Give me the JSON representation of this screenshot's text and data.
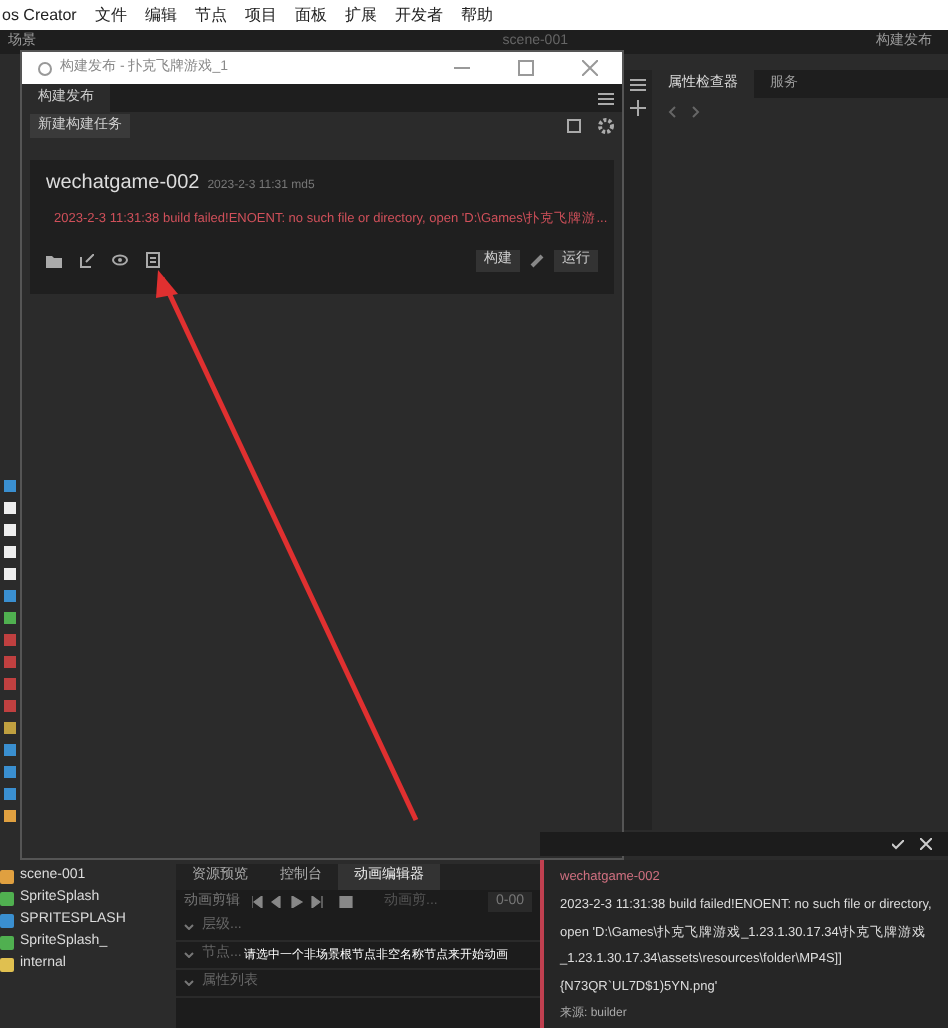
{
  "menu_bar": {
    "app": "os Creator",
    "items": [
      "文件",
      "编辑",
      "节点",
      "项目",
      "面板",
      "扩展",
      "开发者",
      "帮助"
    ]
  },
  "toolbar": {
    "left": "场景",
    "scene": "scene-001",
    "publish": "构建发布"
  },
  "dialog": {
    "title": "构建发布 - 扑克飞牌游戏_1",
    "tab": "构建发布",
    "new_task": "新建构建任务",
    "task": {
      "name": "wechatgame-002",
      "meta": "2023-2-3 11:31 md5",
      "error": "2023-2-3 11:31:38 build failed!ENOENT: no such file or directory, open 'D:\\Games\\扑克飞牌游...",
      "build": "构建",
      "run": "运行"
    }
  },
  "inspector": {
    "tabs": [
      {
        "label": "属性检查器",
        "selected": true
      },
      {
        "label": "服务",
        "selected": false
      }
    ]
  },
  "assets": [
    {
      "kind": "scene",
      "name": "scene-001"
    },
    {
      "kind": "prefab",
      "name": "SpriteSplash"
    },
    {
      "kind": "script",
      "name": "SPRITESPLASH"
    },
    {
      "kind": "prefab",
      "name": "SpriteSplash_"
    },
    {
      "kind": "folder",
      "name": "internal"
    }
  ],
  "bottom_panel": {
    "tabs": [
      {
        "label": "资源预览",
        "selected": false
      },
      {
        "label": "控制台",
        "selected": false
      },
      {
        "label": "动画编辑器",
        "selected": true
      }
    ],
    "clip_label": "动画剪辑",
    "clip_select": "动画剪...",
    "time": "0-00",
    "rows": [
      "层级...",
      "节点...",
      "属性列表"
    ],
    "hint": "请选中一个非场景根节点非空名称节点来开始动画"
  },
  "notification": {
    "title": "wechatgame-002",
    "lines": [
      "2023-2-3 11:31:38 build failed!ENOENT: no such file or directory,",
      "open 'D:\\Games\\扑克飞牌游戏_1.23.1.30.17.34\\扑克飞牌游戏",
      "_1.23.1.30.17.34\\assets\\resources\\folder\\MP4S]]",
      "{N73QR`UL7D$1)5YN.png'"
    ],
    "source": "来源: builder"
  }
}
